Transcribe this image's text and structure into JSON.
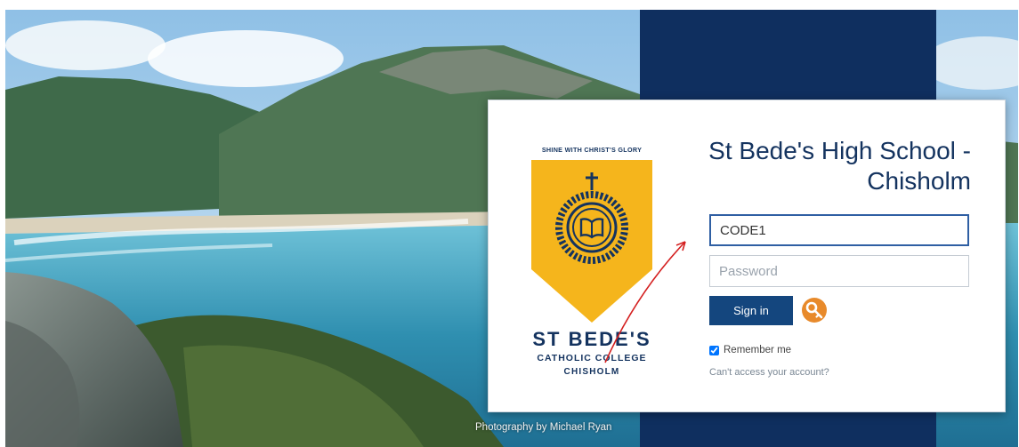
{
  "background": {
    "photo_credit": "Photography by Michael Ryan"
  },
  "logo": {
    "motto": "SHINE WITH CHRIST'S GLORY",
    "name_line1": "ST BEDE'S",
    "name_line2": "CATHOLIC COLLEGE",
    "name_line3": "CHISHOLM",
    "colors": {
      "shield": "#f5b51c",
      "text": "#14335f"
    }
  },
  "login": {
    "title_line1": "St Bede's High School -",
    "title_line2": "Chisholm",
    "username_value": "CODE1",
    "password_placeholder": "Password",
    "signin_label": "Sign in",
    "alt_signin_icon": "key-icon",
    "remember_label": "Remember me",
    "remember_checked": true,
    "cant_access_label": "Can't access your account?"
  },
  "colors": {
    "brand_navy": "#0f2f5f",
    "button": "#14467e",
    "title": "#14335f",
    "key_badge": "#e88a2b",
    "annotation": "#d42020"
  }
}
